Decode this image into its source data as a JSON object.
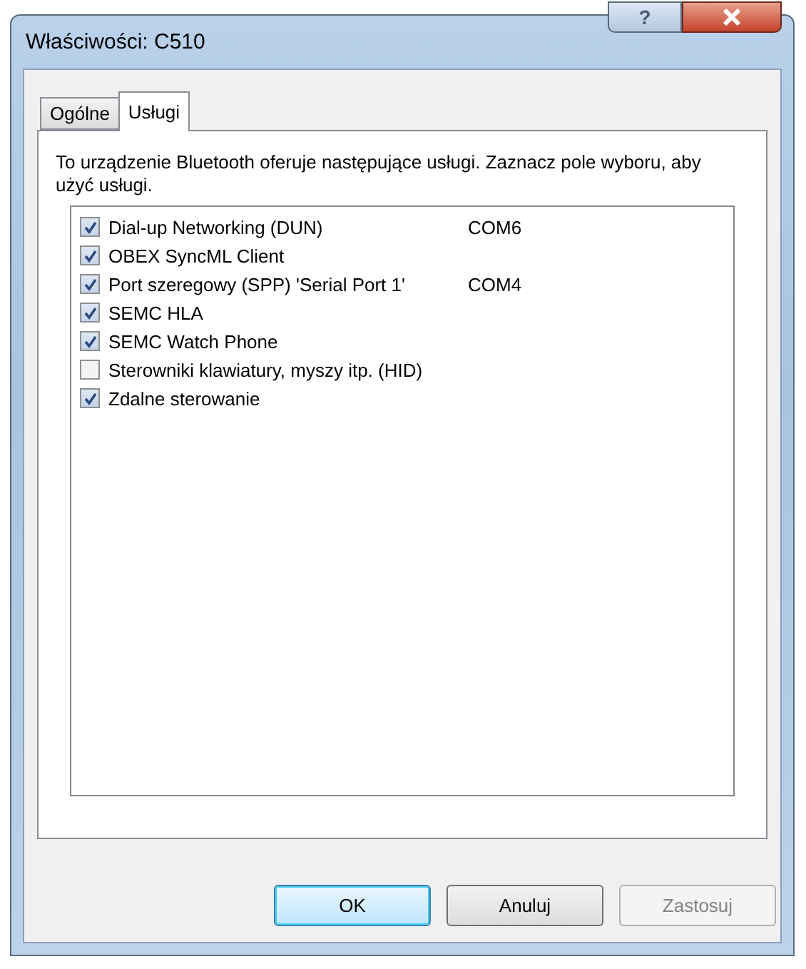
{
  "window": {
    "title": "Właściwości: C510",
    "help": "?"
  },
  "tabs": [
    {
      "label": "Ogólne",
      "selected": false
    },
    {
      "label": "Usługi",
      "selected": true
    }
  ],
  "description": "To urządzenie Bluetooth oferuje następujące usługi. Zaznacz pole wyboru, aby użyć usługi.",
  "services": [
    {
      "name": "Dial-up Networking (DUN)",
      "port": "COM6",
      "checked": true
    },
    {
      "name": "OBEX SyncML Client",
      "checked": true
    },
    {
      "name": "Port szeregowy (SPP) 'Serial Port 1'",
      "port": "COM4",
      "checked": true
    },
    {
      "name": "SEMC HLA",
      "checked": true
    },
    {
      "name": "SEMC Watch Phone",
      "checked": true
    },
    {
      "name": "Sterowniki klawiatury, myszy itp. (HID)",
      "checked": false
    },
    {
      "name": "Zdalne sterowanie",
      "checked": true
    }
  ],
  "buttons": [
    {
      "label": "OK",
      "default": true,
      "disabled": false
    },
    {
      "label": "Anuluj",
      "default": false,
      "disabled": false
    },
    {
      "label": "Zastosuj",
      "default": false,
      "disabled": true
    }
  ]
}
